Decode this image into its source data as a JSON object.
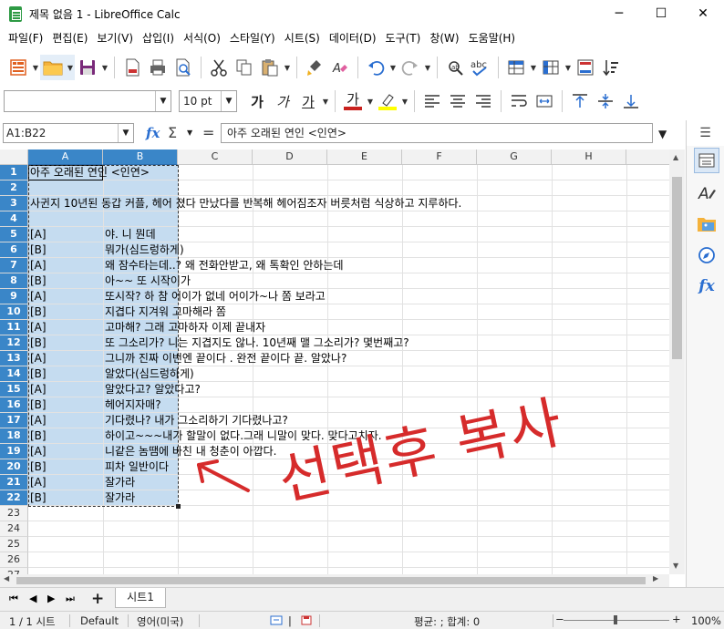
{
  "window": {
    "title": "제목 없음 1 - LibreOffice Calc",
    "minimize": "─",
    "maximize": "☐",
    "close": "✕"
  },
  "menu": [
    "파일(F)",
    "편집(E)",
    "보기(V)",
    "삽입(I)",
    "서식(O)",
    "스타일(Y)",
    "시트(S)",
    "데이터(D)",
    "도구(T)",
    "창(W)",
    "도움말(H)"
  ],
  "format_bar": {
    "font_name": "",
    "font_size": "10 pt"
  },
  "formula_bar": {
    "name_box": "A1:B22",
    "content": "아주 오래된 연인 <인연>"
  },
  "columns": [
    "A",
    "B",
    "C",
    "D",
    "E",
    "F",
    "G",
    "H"
  ],
  "rows": [
    "1",
    "2",
    "3",
    "4",
    "5",
    "6",
    "7",
    "8",
    "9",
    "10",
    "11",
    "12",
    "13",
    "14",
    "15",
    "16",
    "17",
    "18",
    "19",
    "20",
    "21",
    "22",
    "23",
    "24",
    "25",
    "26",
    "27"
  ],
  "cells": {
    "r1_a": "아주 오래된 연인 <인연>",
    "r3_a": "사귄지 10년된 동갑 커플, 헤어 졌다 만났다를 반복해 헤어짐조자 버릇처럼 식상하고 지루하다.",
    "r5_a": "[A]",
    "r5_b": "야. 니 뭔데",
    "r6_a": "[B]",
    "r6_b": "뭐가(심드렁하게)",
    "r7_a": "[A]",
    "r7_b": "왜 잠수타는데..? 왜 전화안받고, 왜 톡확인 안하는데",
    "r8_a": "[B]",
    "r8_b": "아~~ 또 시작이가",
    "r9_a": "[A]",
    "r9_b": "또시작? 하 참 어이가 없네 어이가~나 쫌 보라고",
    "r10_a": "[B]",
    "r10_b": "지겹다 지겨워 고마해라 쫌",
    "r11_a": "[A]",
    "r11_b": "고마해? 그래 고마하자 이제 끝내자",
    "r12_a": "[B]",
    "r12_b": "또 그소리가? 니는 지겹지도 않나. 10년째 맬 그소리가? 몇번째고?",
    "r13_a": "[A]",
    "r13_b": "그니까 진짜 이번엔 끝이다 . 완전 끝이다 끝. 알았나?",
    "r14_a": "[B]",
    "r14_b": "알았다(심드렁하게)",
    "r15_a": "[A]",
    "r15_b": "알았다고? 알았다고?",
    "r16_a": "[B]",
    "r16_b": "헤어지자매?",
    "r17_a": "[A]",
    "r17_b": "기다렸나? 내가 그소리하기 기다렸나고?",
    "r18_a": "[B]",
    "r18_b": "하이고~~~내가 할말이 없다.그래 니말이 맞다. 맞다고치자.",
    "r19_a": "[A]",
    "r19_b": "니같은 놈땜에 바친 내 청춘이 아깝다.",
    "r20_a": "[B]",
    "r20_b": "피차 일반이다",
    "r21_a": "[A]",
    "r21_b": "잘가라",
    "r22_a": "[B]",
    "r22_b": "잘가라"
  },
  "sheet_tabs": [
    "시트1"
  ],
  "status": {
    "sheet": "1 / 1 시트",
    "style": "Default",
    "language": "영어(미국)",
    "stats": "평균: ; 합계: 0",
    "zoom": "100%"
  },
  "annotation": {
    "text": "선택후 복사",
    "color": "#d62b2b"
  },
  "colors": {
    "selection": "#c5dcf0",
    "header_selected": "#3a86c8",
    "calc_green": "#2e9a44"
  }
}
